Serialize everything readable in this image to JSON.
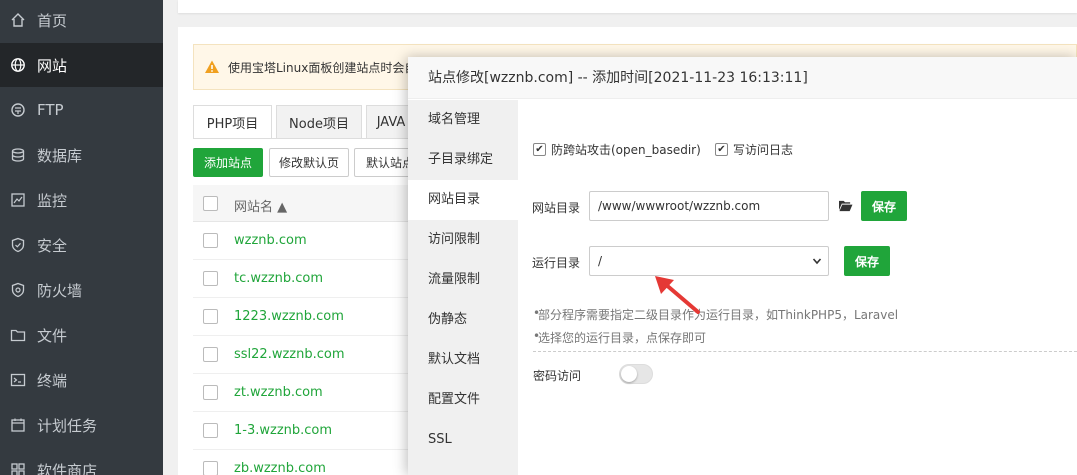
{
  "sidebar": {
    "items": [
      {
        "label": "首页",
        "icon": "home-icon"
      },
      {
        "label": "网站",
        "icon": "globe-icon",
        "active": true
      },
      {
        "label": "FTP",
        "icon": "ftp-icon"
      },
      {
        "label": "数据库",
        "icon": "database-icon"
      },
      {
        "label": "监控",
        "icon": "monitor-icon"
      },
      {
        "label": "安全",
        "icon": "shield-icon"
      },
      {
        "label": "防火墙",
        "icon": "firewall-icon"
      },
      {
        "label": "文件",
        "icon": "folder-icon"
      },
      {
        "label": "终端",
        "icon": "terminal-icon"
      },
      {
        "label": "计划任务",
        "icon": "calendar-icon"
      },
      {
        "label": "软件商店",
        "icon": "apps-icon"
      }
    ]
  },
  "page": {
    "alert_text": "使用宝塔Linux面板创建站点时会自",
    "tabs": [
      "PHP项目",
      "Node项目",
      "JAVA"
    ],
    "buttons": {
      "add_site": "添加站点",
      "modify_default": "修改默认页",
      "default_site": "默认站点"
    },
    "table_header": "网站名 ▲",
    "sites": [
      "wzznb.com",
      "tc.wzznb.com",
      "1223.wzznb.com",
      "ssl22.wzznb.com",
      "zt.wzznb.com",
      "1-3.wzznb.com",
      "zb.wzznb.com"
    ]
  },
  "modal": {
    "title": "站点修改[wzznb.com] -- 添加时间[2021-11-23 16:13:11]",
    "menu": [
      "域名管理",
      "子目录绑定",
      "网站目录",
      "访问限制",
      "流量限制",
      "伪静态",
      "默认文档",
      "配置文件",
      "SSL"
    ],
    "active_menu": "网站目录",
    "checkbox_open_basedir": "防跨站攻击(open_basedir)",
    "checkbox_access_log": "写访问日志",
    "site_dir_label": "网站目录",
    "site_dir_value": "/www/wwwroot/wzznb.com",
    "run_dir_label": "运行目录",
    "run_dir_value": "/",
    "save_label": "保存",
    "tip1": "部分程序需要指定二级目录作为运行目录，如ThinkPHP5，Laravel",
    "tip2": "选择您的运行目录，点保存即可",
    "password_access_label": "密码访问",
    "password_access_enabled": false
  },
  "colors": {
    "accent": "#20a53a",
    "sidebar": "#343a40",
    "annotation": "#e53935"
  }
}
